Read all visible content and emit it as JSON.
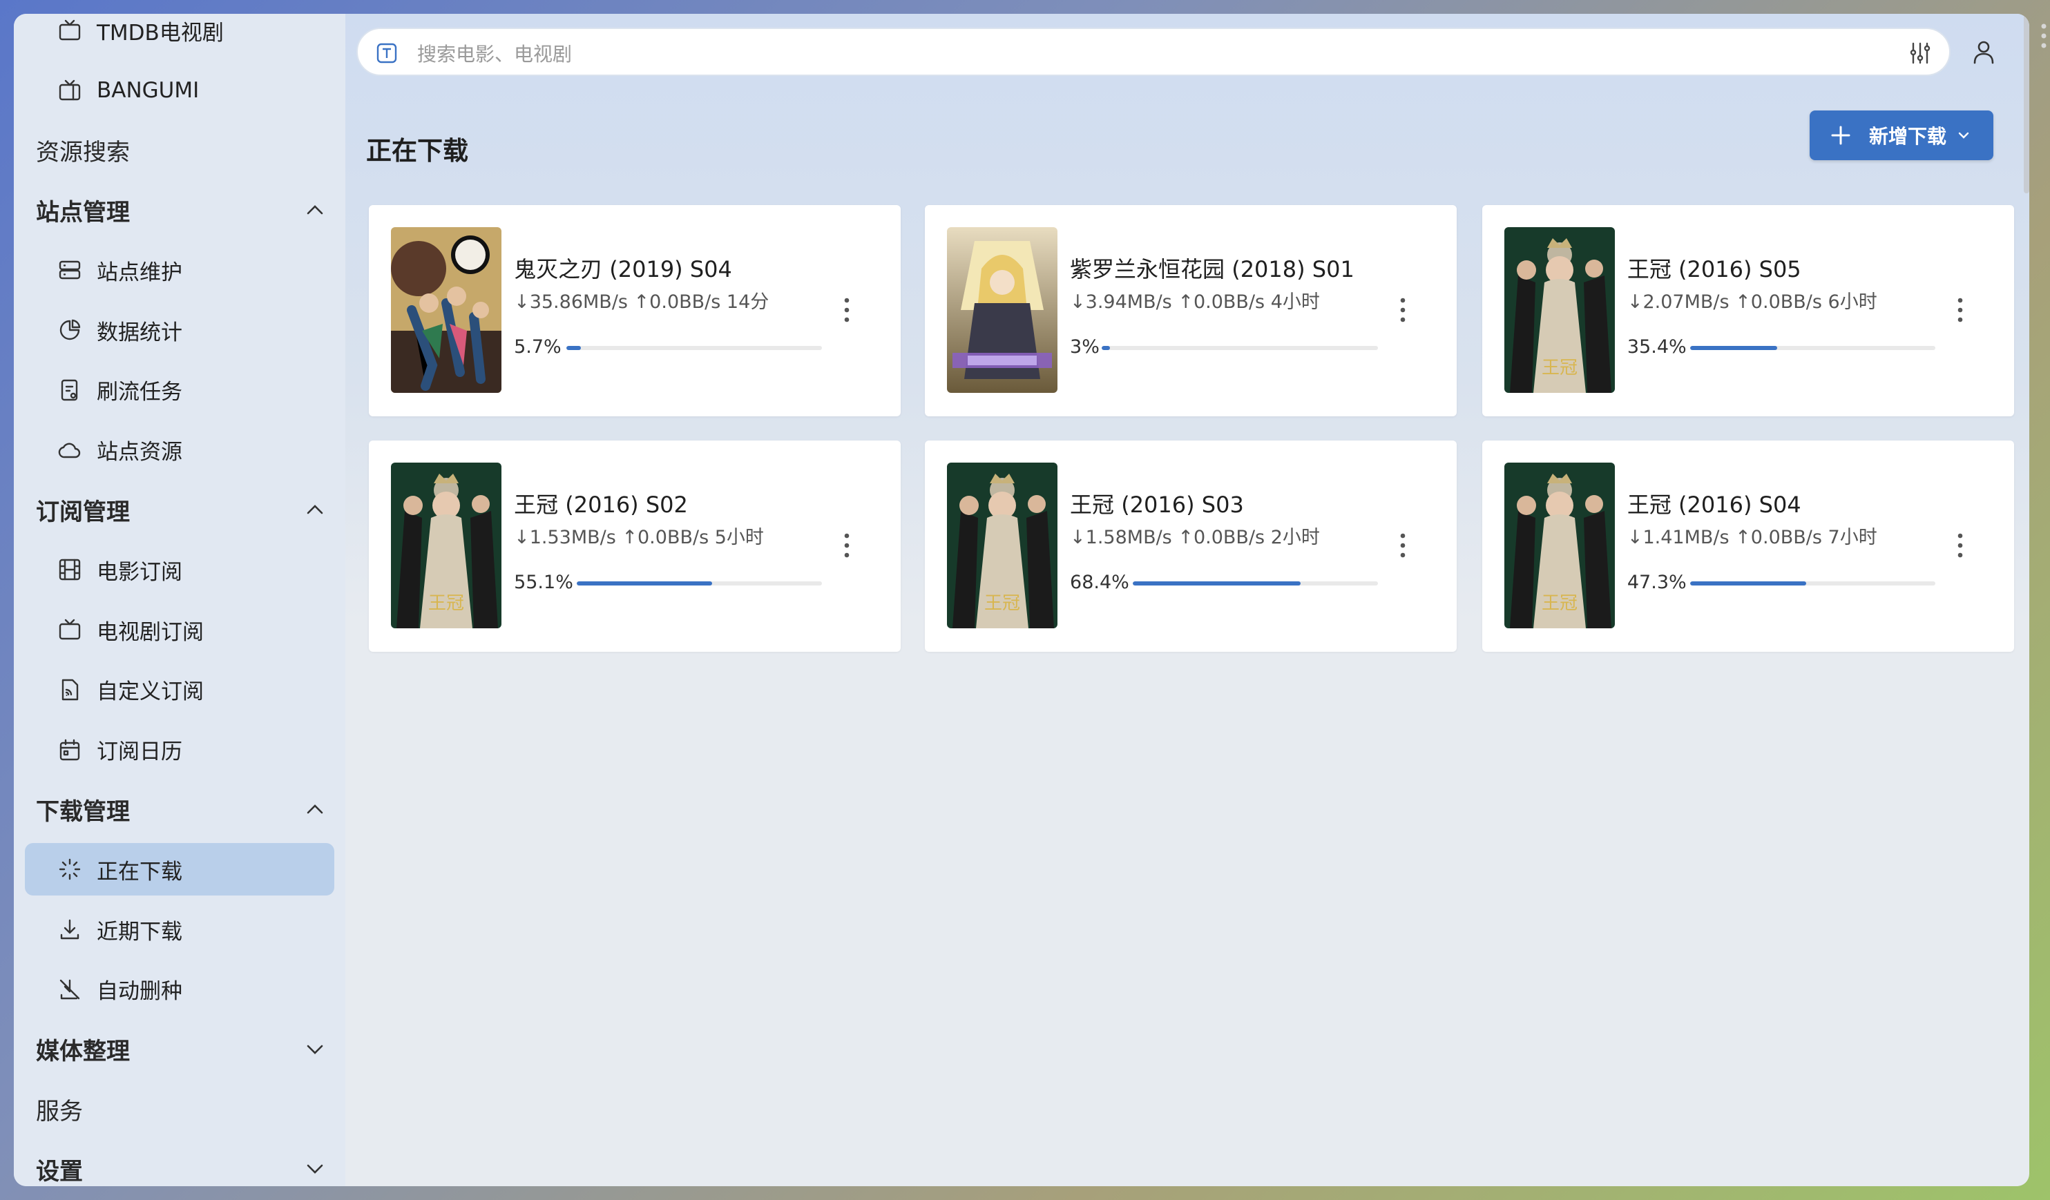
{
  "sidebar": {
    "items": [
      {
        "label": "TMDB电视剧",
        "kind": "sub",
        "icon": "tv-icon"
      },
      {
        "label": "BANGUMI",
        "kind": "sub",
        "icon": "tv-retro-icon"
      },
      {
        "label": "资源搜索",
        "kind": "top"
      },
      {
        "label": "站点管理",
        "kind": "group",
        "expanded": true
      },
      {
        "label": "站点维护",
        "kind": "sub",
        "icon": "server-icon"
      },
      {
        "label": "数据统计",
        "kind": "sub",
        "icon": "pie-chart-icon"
      },
      {
        "label": "刷流任务",
        "kind": "sub",
        "icon": "task-icon"
      },
      {
        "label": "站点资源",
        "kind": "sub",
        "icon": "cloud-icon"
      },
      {
        "label": "订阅管理",
        "kind": "group",
        "expanded": true
      },
      {
        "label": "电影订阅",
        "kind": "sub",
        "icon": "film-icon"
      },
      {
        "label": "电视剧订阅",
        "kind": "sub",
        "icon": "tv-icon"
      },
      {
        "label": "自定义订阅",
        "kind": "sub",
        "icon": "rss-file-icon"
      },
      {
        "label": "订阅日历",
        "kind": "sub",
        "icon": "calendar-icon"
      },
      {
        "label": "下载管理",
        "kind": "group",
        "expanded": true
      },
      {
        "label": "正在下载",
        "kind": "sub",
        "icon": "loader-icon",
        "active": true
      },
      {
        "label": "近期下载",
        "kind": "sub",
        "icon": "download-icon"
      },
      {
        "label": "自动删种",
        "kind": "sub",
        "icon": "download-off-icon"
      },
      {
        "label": "媒体整理",
        "kind": "group",
        "expanded": false
      },
      {
        "label": "服务",
        "kind": "top"
      },
      {
        "label": "设置",
        "kind": "group",
        "expanded": false
      }
    ]
  },
  "search": {
    "placeholder": "搜索电影、电视剧"
  },
  "page": {
    "title": "正在下载",
    "add_button": "新增下载"
  },
  "colors": {
    "accent": "#3a72c4",
    "active_bg": "#b9cfea",
    "sidebar_bg": "#e1e8f2"
  },
  "downloads": [
    {
      "title": "鬼灭之刃 (2019) S04",
      "speed": "↓35.86MB/s ↑0.0BB/s 14分",
      "progress_label": "5.7%",
      "progress": 5.7,
      "poster": "demon-slayer"
    },
    {
      "title": "紫罗兰永恒花园 (2018) S01",
      "speed": "↓3.94MB/s ↑0.0BB/s 4小时",
      "progress_label": "3%",
      "progress": 3,
      "poster": "violet"
    },
    {
      "title": "王冠 (2016) S05",
      "speed": "↓2.07MB/s ↑0.0BB/s 6小时",
      "progress_label": "35.4%",
      "progress": 35.4,
      "poster": "crown"
    },
    {
      "title": "王冠 (2016) S02",
      "speed": "↓1.53MB/s ↑0.0BB/s 5小时",
      "progress_label": "55.1%",
      "progress": 55.1,
      "poster": "crown"
    },
    {
      "title": "王冠 (2016) S03",
      "speed": "↓1.58MB/s ↑0.0BB/s 2小时",
      "progress_label": "68.4%",
      "progress": 68.4,
      "poster": "crown"
    },
    {
      "title": "王冠 (2016) S04",
      "speed": "↓1.41MB/s ↑0.0BB/s 7小时",
      "progress_label": "47.3%",
      "progress": 47.3,
      "poster": "crown"
    }
  ],
  "poster_text": {
    "crown": "王冠"
  }
}
